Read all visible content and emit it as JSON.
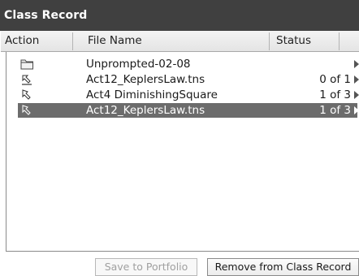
{
  "window": {
    "title": "Class Record"
  },
  "columns": {
    "action": "Action",
    "file_name": "File Name",
    "status": "Status"
  },
  "rows": [
    {
      "icon": "folder-icon",
      "file_name": "Unprompted-02-08",
      "status": "",
      "selected": false
    },
    {
      "icon": "collect-icon",
      "file_name": "Act12_KeplersLaw.tns",
      "status": "0 of 1",
      "selected": false
    },
    {
      "icon": "send-icon",
      "file_name": "Act4 DiminishingSquare",
      "status": "1 of 3",
      "selected": false
    },
    {
      "icon": "send-icon",
      "file_name": "Act12_KeplersLaw.tns",
      "status": "1 of 3",
      "selected": true
    }
  ],
  "buttons": {
    "save_portfolio": "Save to Portfolio",
    "remove": "Remove from Class Record"
  },
  "colors": {
    "titlebar": "#404040",
    "selection": "#6c6c6c"
  }
}
